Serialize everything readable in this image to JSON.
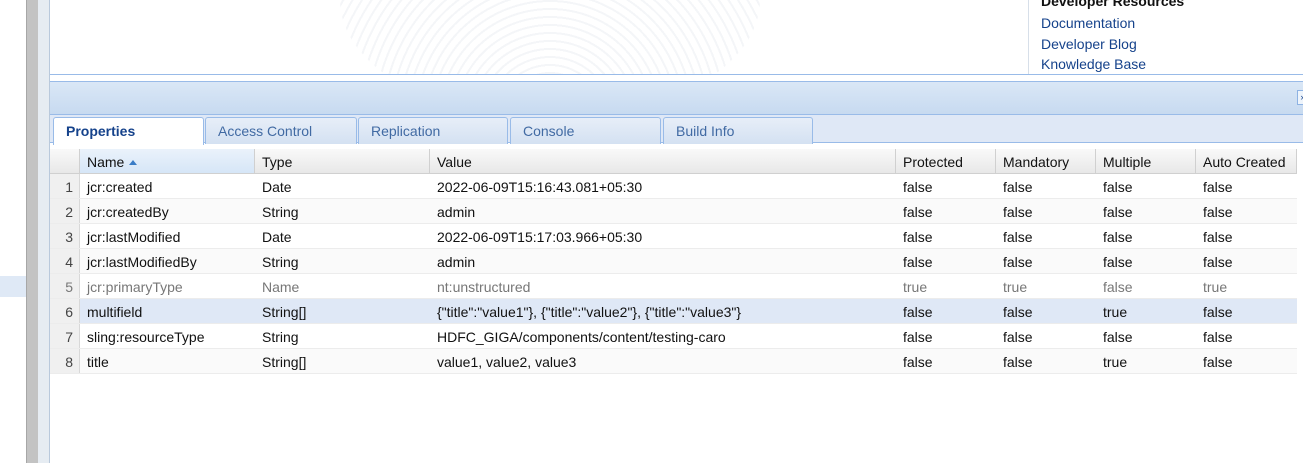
{
  "developer_resources": {
    "heading": "Developer Resources",
    "links": [
      "Documentation",
      "Developer Blog",
      "Knowledge Base"
    ]
  },
  "tabs": [
    {
      "label": "Properties",
      "active": true
    },
    {
      "label": "Access Control",
      "active": false
    },
    {
      "label": "Replication",
      "active": false
    },
    {
      "label": "Console",
      "active": false
    },
    {
      "label": "Build Info",
      "active": false
    }
  ],
  "grid": {
    "columns": [
      "Name",
      "Type",
      "Value",
      "Protected",
      "Mandatory",
      "Multiple",
      "Auto Created"
    ],
    "sorted_column": "Name",
    "sort_direction": "ascending",
    "rows": [
      {
        "n": "1",
        "name": "jcr:created",
        "type": "Date",
        "value": "2022-06-09T15:16:43.081+05:30",
        "protected": "false",
        "mandatory": "false",
        "multiple": "false",
        "auto": "false"
      },
      {
        "n": "2",
        "name": "jcr:createdBy",
        "type": "String",
        "value": "admin",
        "protected": "false",
        "mandatory": "false",
        "multiple": "false",
        "auto": "false"
      },
      {
        "n": "3",
        "name": "jcr:lastModified",
        "type": "Date",
        "value": "2022-06-09T15:17:03.966+05:30",
        "protected": "false",
        "mandatory": "false",
        "multiple": "false",
        "auto": "false"
      },
      {
        "n": "4",
        "name": "jcr:lastModifiedBy",
        "type": "String",
        "value": "admin",
        "protected": "false",
        "mandatory": "false",
        "multiple": "false",
        "auto": "false"
      },
      {
        "n": "5",
        "name": "jcr:primaryType",
        "type": "Name",
        "value": "nt:unstructured",
        "protected": "true",
        "mandatory": "true",
        "multiple": "false",
        "auto": "true"
      },
      {
        "n": "6",
        "name": "multifield",
        "type": "String[]",
        "value": "{\"title\":\"value1\"}, {\"title\":\"value2\"}, {\"title\":\"value3\"}",
        "protected": "false",
        "mandatory": "false",
        "multiple": "true",
        "auto": "false"
      },
      {
        "n": "7",
        "name": "sling:resourceType",
        "type": "String",
        "value": "HDFC_GIGA/components/content/testing-caro",
        "protected": "false",
        "mandatory": "false",
        "multiple": "false",
        "auto": "false"
      },
      {
        "n": "8",
        "name": "title",
        "type": "String[]",
        "value": "value1, value2, value3",
        "protected": "false",
        "mandatory": "false",
        "multiple": "true",
        "auto": "false"
      }
    ]
  },
  "colors": {
    "panel_border": "#99bbe8",
    "tab_text": "#416aa3",
    "selected_row": "#dfe8f6",
    "link": "#15428b"
  }
}
